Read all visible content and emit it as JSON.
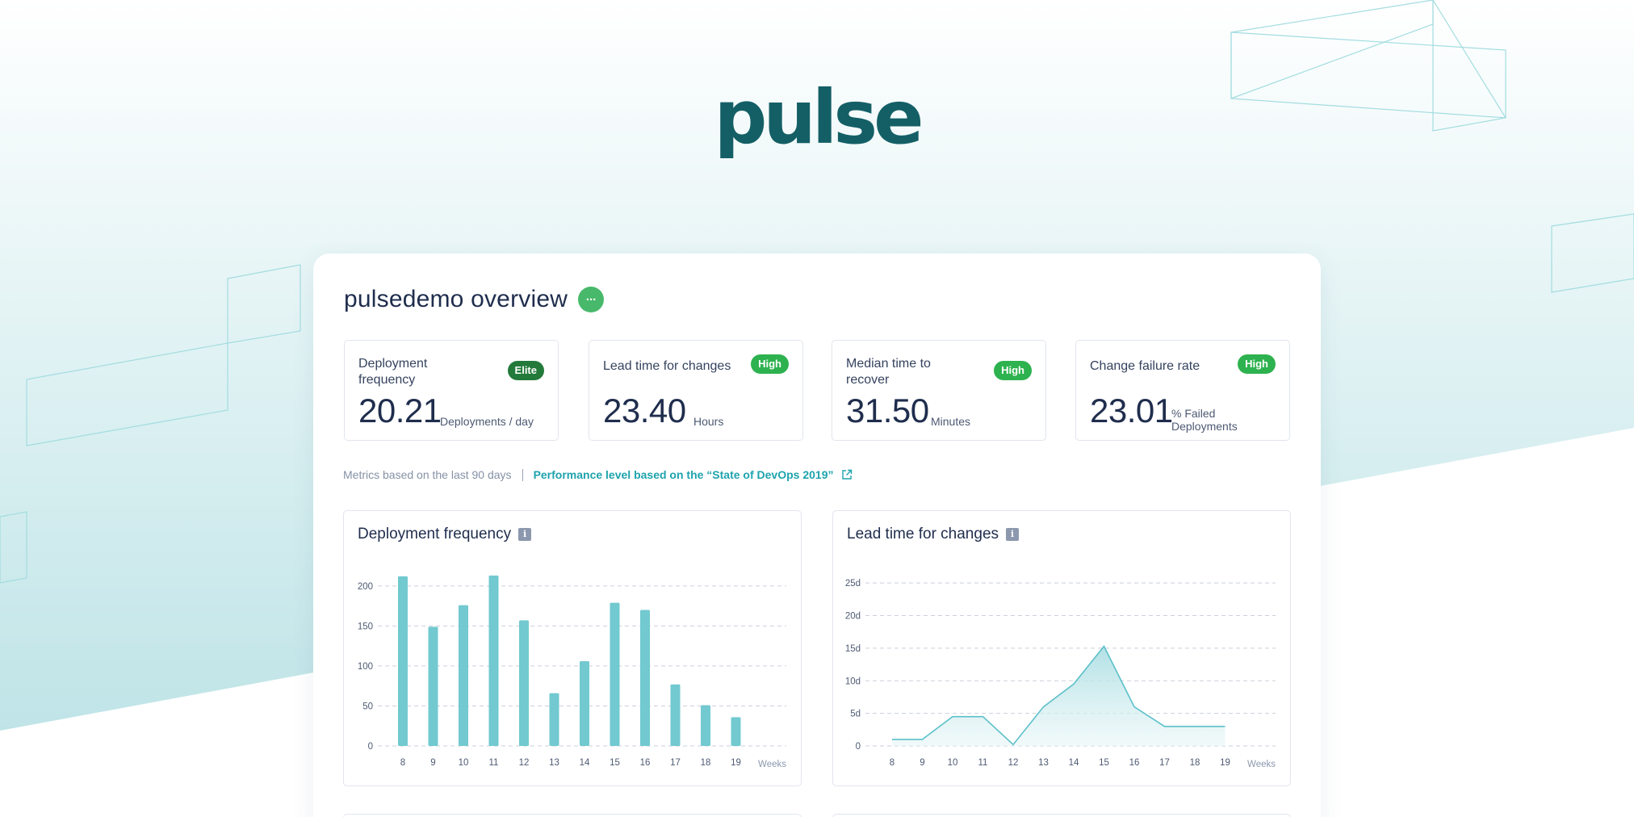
{
  "brand": {
    "logo_text": "pulse",
    "primary_color": "#145f66",
    "accent_color": "#1ea3ad"
  },
  "overview": {
    "title": "pulsedemo overview",
    "more_label": "...",
    "metrics": [
      {
        "label": "Deployment frequency",
        "badge": "Elite",
        "value": "20.21",
        "unit": "Deployments / day"
      },
      {
        "label": "Lead time for changes",
        "badge": "High",
        "value": "23.40",
        "unit": "Hours"
      },
      {
        "label": "Median time to recover",
        "badge": "High",
        "value": "31.50",
        "unit": "Minutes"
      },
      {
        "label": "Change failure rate",
        "badge": "High",
        "value": "23.01",
        "unit": "% Failed Deployments"
      }
    ],
    "footnote": "Metrics based on the last 90 days",
    "performance_link": "Performance level based on the “State of DevOps 2019”",
    "colors": {
      "elite": "#237a3a",
      "high": "#2eb24f",
      "bar": "#72c9d0",
      "line": "#5cc0c9"
    }
  },
  "chart_data": [
    {
      "type": "bar",
      "title": "Deployment frequency",
      "xlabel": "Weeks",
      "ylabel": "",
      "categories": [
        "8",
        "9",
        "10",
        "11",
        "12",
        "13",
        "14",
        "15",
        "16",
        "17",
        "18",
        "19"
      ],
      "values": [
        212,
        149,
        176,
        213,
        157,
        66,
        106,
        179,
        170,
        77,
        51,
        36
      ],
      "yticks": [
        "0",
        "50",
        "100",
        "150",
        "200"
      ],
      "ylim": [
        0,
        220
      ],
      "grid": true
    },
    {
      "type": "area",
      "title": "Lead time for changes",
      "xlabel": "Weeks",
      "ylabel": "",
      "categories": [
        "8",
        "9",
        "10",
        "11",
        "12",
        "13",
        "14",
        "15",
        "16",
        "17",
        "18",
        "19"
      ],
      "values": [
        1,
        1,
        4.5,
        4.5,
        0.2,
        6,
        9.5,
        15.3,
        6,
        3,
        3,
        3
      ],
      "yticks": [
        "0",
        "5d",
        "10d",
        "15d",
        "20d",
        "25d"
      ],
      "ylim": [
        0,
        27
      ],
      "grid": true
    }
  ]
}
